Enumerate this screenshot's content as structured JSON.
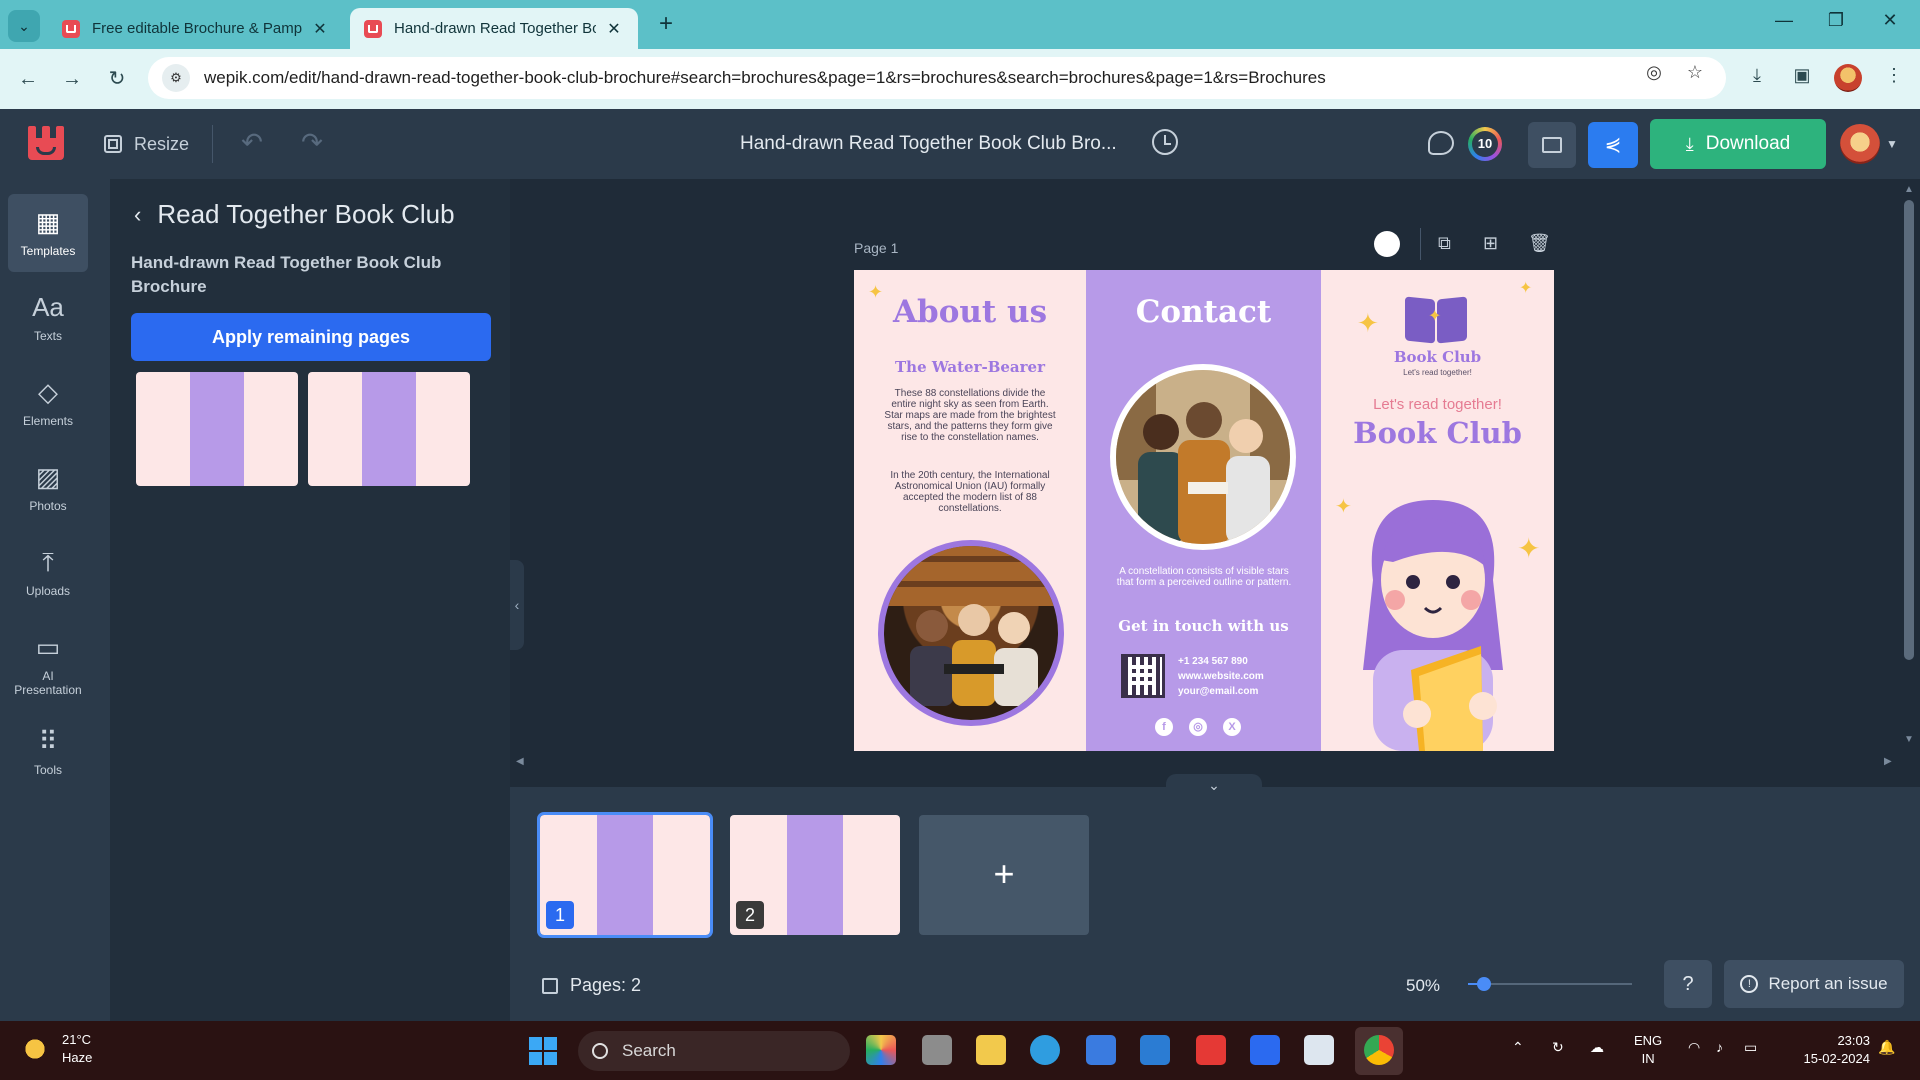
{
  "browser": {
    "tabs": [
      {
        "title": "Free editable Brochure & Pamphlet templates",
        "active": false
      },
      {
        "title": "Hand-drawn Read Together Book Club Brochure",
        "active": true
      }
    ],
    "url": "wepik.com/edit/hand-drawn-read-together-book-club-brochure#search=brochures&page=1&rs=brochures&search=brochures&page=1&rs=Brochures"
  },
  "header": {
    "resize_label": "Resize",
    "doc_title": "Hand-drawn Read Together Book Club Bro...",
    "credits": "10",
    "download_label": "Download"
  },
  "rail": {
    "items": [
      {
        "label": "Templates",
        "icon": "templates-icon"
      },
      {
        "label": "Texts",
        "icon": "texts-icon"
      },
      {
        "label": "Elements",
        "icon": "elements-icon"
      },
      {
        "label": "Photos",
        "icon": "photos-icon"
      },
      {
        "label": "Uploads",
        "icon": "uploads-icon"
      },
      {
        "label": "AI Presentation",
        "icon": "ai-presentation-icon"
      },
      {
        "label": "Tools",
        "icon": "tools-icon"
      }
    ]
  },
  "panel": {
    "back_title": "Read Together Book Club",
    "subtitle": "Hand-drawn Read Together Book Club Brochure",
    "apply_label": "Apply remaining pages"
  },
  "canvas": {
    "page_label": "Page 1"
  },
  "brochure": {
    "about_title": "About us",
    "about_subtitle": "The Water-Bearer",
    "about_p1": "These 88 constellations divide the entire night sky as seen from Earth. Star maps are made from the brightest stars, and the patterns they form give rise to the constellation names.",
    "about_p2": "In the 20th century, the International Astronomical Union (IAU) formally accepted the modern list of 88 constellations.",
    "contact_title": "Contact",
    "contact_p": "A constellation consists of visible stars that form a perceived outline or pattern.",
    "touch_title": "Get in touch with us",
    "phone": "+1 234 567 890",
    "website": "www.website.com",
    "email": "your@email.com",
    "logo_text": "Book Club",
    "logo_tag": "Let's read together!",
    "lets_read": "Let's read together!",
    "big_title": "Book Club"
  },
  "pages": {
    "thumbs": [
      "1",
      "2"
    ],
    "count_label": "Pages: 2",
    "zoom": "50%",
    "zoom_fraction": 0.1,
    "report_label": "Report an issue"
  },
  "taskbar": {
    "temp": "21°C",
    "condition": "Haze",
    "search_label": "Search",
    "lang1": "ENG",
    "lang2": "IN",
    "time": "23:03",
    "date": "15-02-2024"
  },
  "colors": {
    "accent": "#2b6af0",
    "download": "#2db37d",
    "brochure_purple": "#b79ae8",
    "brochure_pink": "#fde7e7"
  }
}
